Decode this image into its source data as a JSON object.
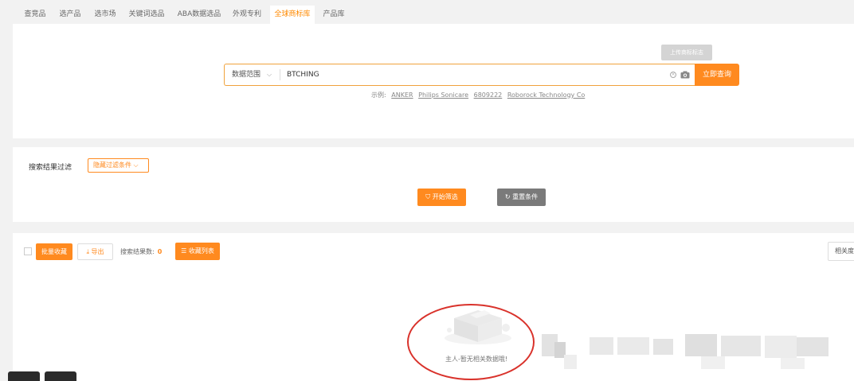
{
  "tabs": [
    {
      "label": "查竞品",
      "active": false
    },
    {
      "label": "选产品",
      "active": false
    },
    {
      "label": "选市场",
      "active": false
    },
    {
      "label": "关键词选品",
      "active": false
    },
    {
      "label": "ABA数据选品",
      "active": false
    },
    {
      "label": "外观专利",
      "active": false
    },
    {
      "label": "全球商标库",
      "active": true
    },
    {
      "label": "产品库",
      "active": false
    }
  ],
  "search": {
    "tooltip": "上传商标标志",
    "scope_label": "数据范围",
    "value": "BTCHING",
    "button_label": "立即查询",
    "examples_prefix": "示例:",
    "examples": [
      "ANKER",
      "Philips Sonicare",
      "6809222",
      "Roborock Technology Co"
    ]
  },
  "filter": {
    "label": "搜索结果过滤",
    "toggle_label": "隐藏过滤条件",
    "start_label": "开始筛选",
    "reset_label": "重置条件"
  },
  "results": {
    "batch_label": "批量收藏",
    "export_label": "导出",
    "count_label": "搜索结果数:",
    "count_value": "0",
    "fav_list_label": "收藏列表",
    "sort_label": "相关度",
    "empty_text": "主人-暂无相关数据哦!"
  },
  "colors": {
    "accent": "#ff8a1f",
    "annotation": "#d9322b"
  }
}
